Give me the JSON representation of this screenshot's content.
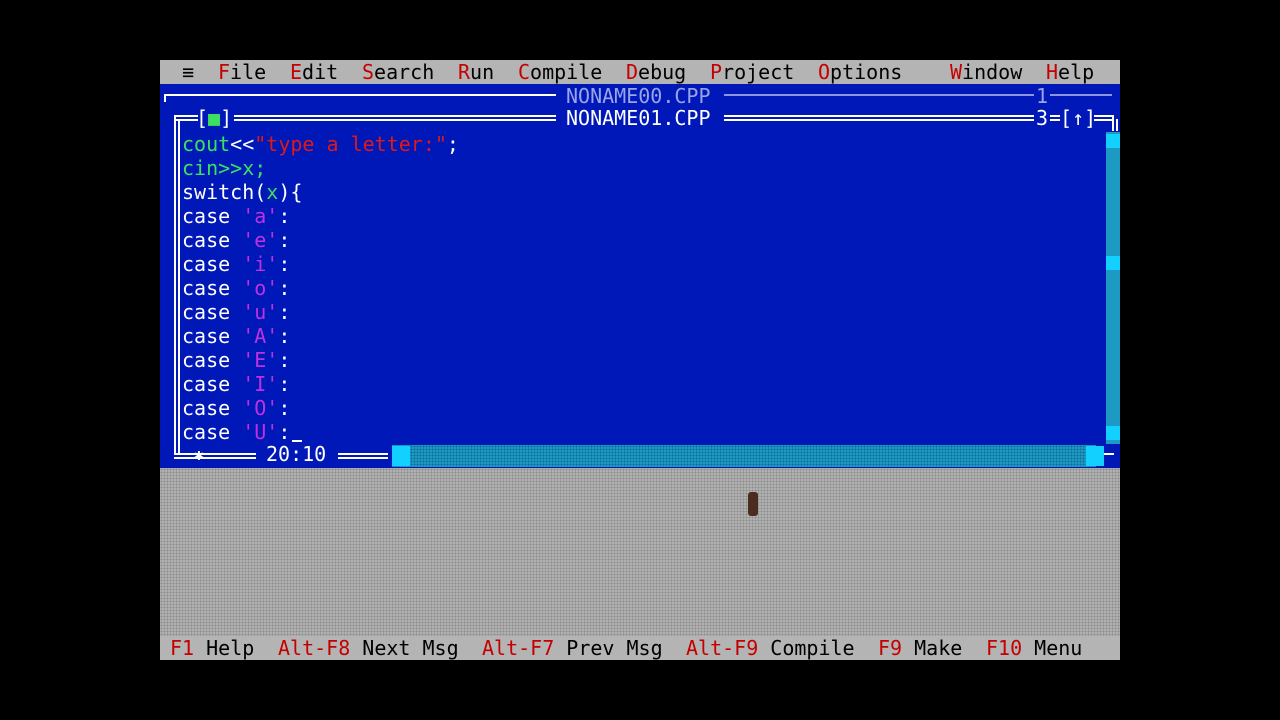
{
  "menu": {
    "system": "≡",
    "items": [
      {
        "hot": "F",
        "rest": "ile"
      },
      {
        "hot": "E",
        "rest": "dit"
      },
      {
        "hot": "S",
        "rest": "earch"
      },
      {
        "hot": "R",
        "rest": "un"
      },
      {
        "hot": "C",
        "rest": "ompile"
      },
      {
        "hot": "D",
        "rest": "ebug"
      },
      {
        "hot": "P",
        "rest": "roject"
      },
      {
        "hot": "O",
        "rest": "ptions"
      },
      {
        "hot": "W",
        "rest": "indow"
      },
      {
        "hot": "H",
        "rest": "elp"
      }
    ]
  },
  "back_window": {
    "title": "NONAME00.CPP",
    "number": "1"
  },
  "front_window": {
    "title": "NONAME01.CPP",
    "close_box": "[■]",
    "number": "3",
    "zoom_box": "[↑]",
    "cursor_pos": "20:10",
    "resize_glyph": "✱"
  },
  "code": {
    "l1": {
      "a": "cout",
      "b": "<<",
      "c": "\"type a letter:\"",
      "d": ";"
    },
    "l2": {
      "a": "cin",
      "b": ">>x;"
    },
    "l3": {
      "a": "switch(",
      "b": "x",
      "c": "){"
    },
    "cases": [
      {
        "kw": "case ",
        "ch": "'a'",
        "colon": ":"
      },
      {
        "kw": "case ",
        "ch": "'e'",
        "colon": ":"
      },
      {
        "kw": "case ",
        "ch": "'i'",
        "colon": ":"
      },
      {
        "kw": "case ",
        "ch": "'o'",
        "colon": ":"
      },
      {
        "kw": "case ",
        "ch": "'u'",
        "colon": ":"
      },
      {
        "kw": "case ",
        "ch": "'A'",
        "colon": ":"
      },
      {
        "kw": "case ",
        "ch": "'E'",
        "colon": ":"
      },
      {
        "kw": "case ",
        "ch": "'I'",
        "colon": ":"
      },
      {
        "kw": "case ",
        "ch": "'O'",
        "colon": ":"
      },
      {
        "kw": "case ",
        "ch": "'U'",
        "colon": ":"
      }
    ]
  },
  "status": [
    {
      "key": "F1",
      "label": " Help"
    },
    {
      "key": "Alt-F8",
      "label": " Next Msg"
    },
    {
      "key": "Alt-F7",
      "label": " Prev Msg"
    },
    {
      "key": "Alt-F9",
      "label": " Compile"
    },
    {
      "key": "F9",
      "label": " Make"
    },
    {
      "key": "F10",
      "label": " Menu"
    }
  ],
  "colors": {
    "desktop_blue": "#0018b8",
    "menu_gray": "#b4b4b4",
    "hotkey_red": "#c40000",
    "string_red": "#e01818",
    "char_magenta": "#c030e0",
    "io_green": "#3ce060",
    "scroll_cyan": "#1c9ac4"
  }
}
